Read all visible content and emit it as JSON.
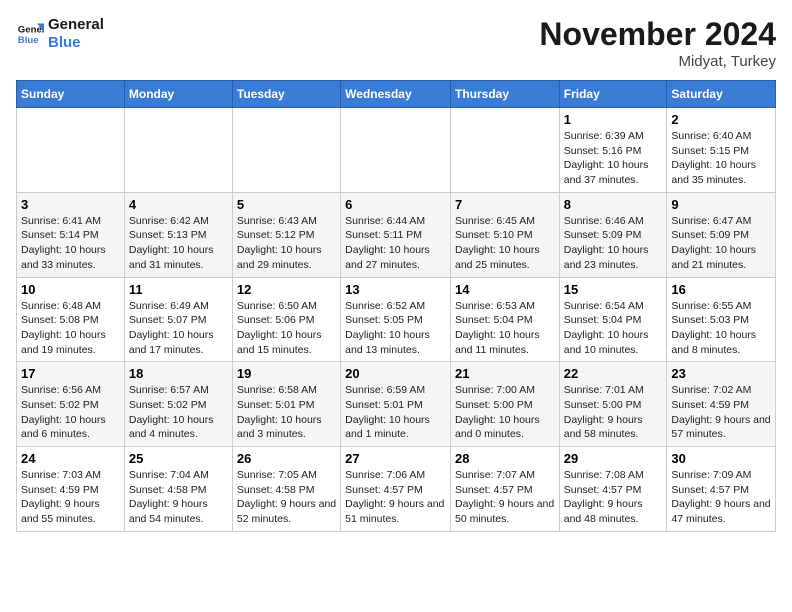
{
  "logo": {
    "line1": "General",
    "line2": "Blue"
  },
  "title": "November 2024",
  "location": "Midyat, Turkey",
  "days_of_week": [
    "Sunday",
    "Monday",
    "Tuesday",
    "Wednesday",
    "Thursday",
    "Friday",
    "Saturday"
  ],
  "weeks": [
    [
      {
        "day": "",
        "content": ""
      },
      {
        "day": "",
        "content": ""
      },
      {
        "day": "",
        "content": ""
      },
      {
        "day": "",
        "content": ""
      },
      {
        "day": "",
        "content": ""
      },
      {
        "day": "1",
        "content": "Sunrise: 6:39 AM\nSunset: 5:16 PM\nDaylight: 10 hours and 37 minutes."
      },
      {
        "day": "2",
        "content": "Sunrise: 6:40 AM\nSunset: 5:15 PM\nDaylight: 10 hours and 35 minutes."
      }
    ],
    [
      {
        "day": "3",
        "content": "Sunrise: 6:41 AM\nSunset: 5:14 PM\nDaylight: 10 hours and 33 minutes."
      },
      {
        "day": "4",
        "content": "Sunrise: 6:42 AM\nSunset: 5:13 PM\nDaylight: 10 hours and 31 minutes."
      },
      {
        "day": "5",
        "content": "Sunrise: 6:43 AM\nSunset: 5:12 PM\nDaylight: 10 hours and 29 minutes."
      },
      {
        "day": "6",
        "content": "Sunrise: 6:44 AM\nSunset: 5:11 PM\nDaylight: 10 hours and 27 minutes."
      },
      {
        "day": "7",
        "content": "Sunrise: 6:45 AM\nSunset: 5:10 PM\nDaylight: 10 hours and 25 minutes."
      },
      {
        "day": "8",
        "content": "Sunrise: 6:46 AM\nSunset: 5:09 PM\nDaylight: 10 hours and 23 minutes."
      },
      {
        "day": "9",
        "content": "Sunrise: 6:47 AM\nSunset: 5:09 PM\nDaylight: 10 hours and 21 minutes."
      }
    ],
    [
      {
        "day": "10",
        "content": "Sunrise: 6:48 AM\nSunset: 5:08 PM\nDaylight: 10 hours and 19 minutes."
      },
      {
        "day": "11",
        "content": "Sunrise: 6:49 AM\nSunset: 5:07 PM\nDaylight: 10 hours and 17 minutes."
      },
      {
        "day": "12",
        "content": "Sunrise: 6:50 AM\nSunset: 5:06 PM\nDaylight: 10 hours and 15 minutes."
      },
      {
        "day": "13",
        "content": "Sunrise: 6:52 AM\nSunset: 5:05 PM\nDaylight: 10 hours and 13 minutes."
      },
      {
        "day": "14",
        "content": "Sunrise: 6:53 AM\nSunset: 5:04 PM\nDaylight: 10 hours and 11 minutes."
      },
      {
        "day": "15",
        "content": "Sunrise: 6:54 AM\nSunset: 5:04 PM\nDaylight: 10 hours and 10 minutes."
      },
      {
        "day": "16",
        "content": "Sunrise: 6:55 AM\nSunset: 5:03 PM\nDaylight: 10 hours and 8 minutes."
      }
    ],
    [
      {
        "day": "17",
        "content": "Sunrise: 6:56 AM\nSunset: 5:02 PM\nDaylight: 10 hours and 6 minutes."
      },
      {
        "day": "18",
        "content": "Sunrise: 6:57 AM\nSunset: 5:02 PM\nDaylight: 10 hours and 4 minutes."
      },
      {
        "day": "19",
        "content": "Sunrise: 6:58 AM\nSunset: 5:01 PM\nDaylight: 10 hours and 3 minutes."
      },
      {
        "day": "20",
        "content": "Sunrise: 6:59 AM\nSunset: 5:01 PM\nDaylight: 10 hours and 1 minute."
      },
      {
        "day": "21",
        "content": "Sunrise: 7:00 AM\nSunset: 5:00 PM\nDaylight: 10 hours and 0 minutes."
      },
      {
        "day": "22",
        "content": "Sunrise: 7:01 AM\nSunset: 5:00 PM\nDaylight: 9 hours and 58 minutes."
      },
      {
        "day": "23",
        "content": "Sunrise: 7:02 AM\nSunset: 4:59 PM\nDaylight: 9 hours and 57 minutes."
      }
    ],
    [
      {
        "day": "24",
        "content": "Sunrise: 7:03 AM\nSunset: 4:59 PM\nDaylight: 9 hours and 55 minutes."
      },
      {
        "day": "25",
        "content": "Sunrise: 7:04 AM\nSunset: 4:58 PM\nDaylight: 9 hours and 54 minutes."
      },
      {
        "day": "26",
        "content": "Sunrise: 7:05 AM\nSunset: 4:58 PM\nDaylight: 9 hours and 52 minutes."
      },
      {
        "day": "27",
        "content": "Sunrise: 7:06 AM\nSunset: 4:57 PM\nDaylight: 9 hours and 51 minutes."
      },
      {
        "day": "28",
        "content": "Sunrise: 7:07 AM\nSunset: 4:57 PM\nDaylight: 9 hours and 50 minutes."
      },
      {
        "day": "29",
        "content": "Sunrise: 7:08 AM\nSunset: 4:57 PM\nDaylight: 9 hours and 48 minutes."
      },
      {
        "day": "30",
        "content": "Sunrise: 7:09 AM\nSunset: 4:57 PM\nDaylight: 9 hours and 47 minutes."
      }
    ]
  ]
}
